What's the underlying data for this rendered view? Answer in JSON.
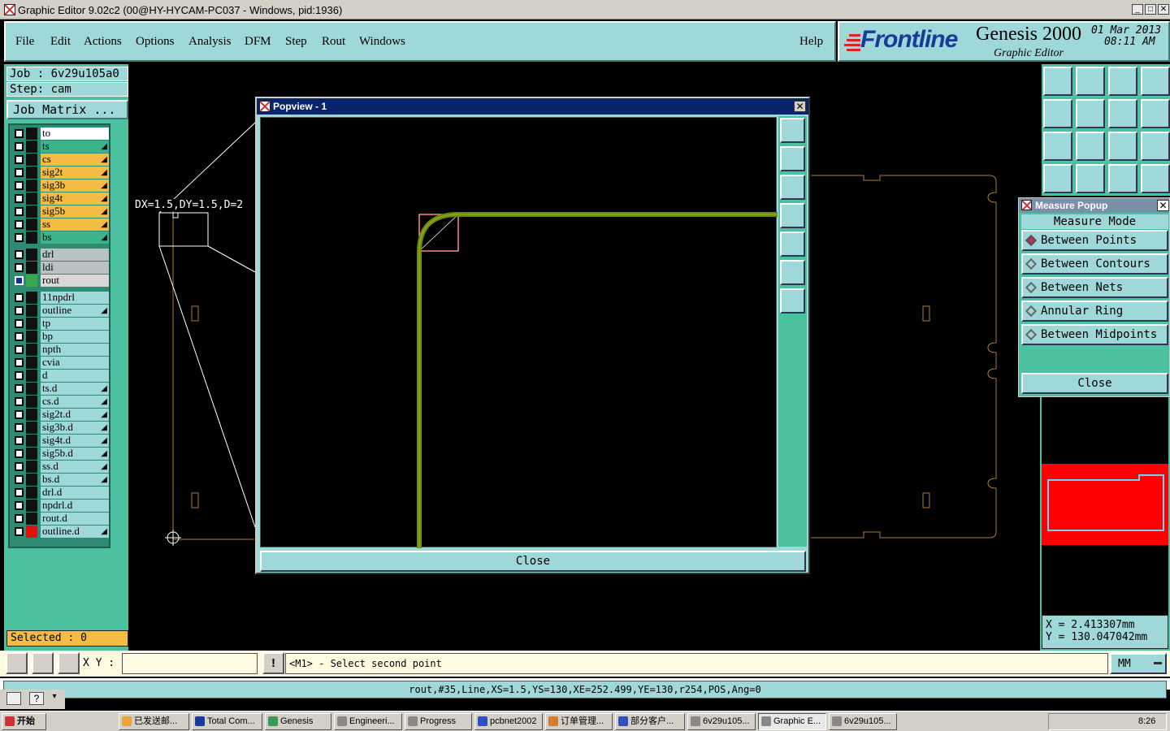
{
  "window": {
    "title": "Graphic Editor 9.02c2 (00@HY-HYCAM-PC037 - Windows, pid:1936)"
  },
  "menu": {
    "items": [
      "File",
      "Edit",
      "Actions",
      "Options",
      "Analysis",
      "DFM",
      "Step",
      "Rout",
      "Windows"
    ],
    "help": "Help"
  },
  "brand": {
    "logo": "Frontline",
    "product": "Genesis 2000",
    "subtitle": "Graphic Editor",
    "date": "01 Mar 2013",
    "time": "08:11 AM"
  },
  "left": {
    "job": "Job  : 6v29u105a0",
    "step": "Step: cam",
    "job_matrix": "Job Matrix ...",
    "selected": "Selected : 0",
    "layers": [
      {
        "name": "to",
        "color": "#ffffff",
        "swatch": "#111111"
      },
      {
        "name": "ts",
        "color": "#3cb38a",
        "swatch": "#111111",
        "arrow": true
      },
      {
        "name": "cs",
        "color": "#f5bc43",
        "swatch": "#111111",
        "arrow": true
      },
      {
        "name": "sig2t",
        "color": "#f5bc43",
        "swatch": "#111111",
        "arrow": true
      },
      {
        "name": "sig3b",
        "color": "#f5bc43",
        "swatch": "#111111",
        "arrow": true
      },
      {
        "name": "sig4t",
        "color": "#f5bc43",
        "swatch": "#111111",
        "arrow": true
      },
      {
        "name": "sig5b",
        "color": "#f5bc43",
        "swatch": "#111111",
        "arrow": true
      },
      {
        "name": "ss",
        "color": "#f5bc43",
        "swatch": "#111111",
        "arrow": true
      },
      {
        "name": "bs",
        "color": "#3cb38a",
        "swatch": "#111111",
        "arrow": true
      },
      {
        "name": "drl",
        "color": "#b8c4c4",
        "swatch": "#111111"
      },
      {
        "name": "ldi",
        "color": "#b8c4c4",
        "swatch": "#111111"
      },
      {
        "name": "rout",
        "color": "#d8d8d8",
        "swatch": "#3aa84a",
        "active": true
      },
      {
        "name": "11npdrl",
        "color": "#9ed8d8",
        "swatch": "#111111"
      },
      {
        "name": "outline",
        "color": "#9ed8d8",
        "swatch": "#111111",
        "arrow": true
      },
      {
        "name": "tp",
        "color": "#9ed8d8",
        "swatch": "#111111"
      },
      {
        "name": "bp",
        "color": "#9ed8d8",
        "swatch": "#111111"
      },
      {
        "name": "npth",
        "color": "#9ed8d8",
        "swatch": "#111111"
      },
      {
        "name": "cvia",
        "color": "#9ed8d8",
        "swatch": "#111111"
      },
      {
        "name": "d",
        "color": "#9ed8d8",
        "swatch": "#111111"
      },
      {
        "name": "ts.d",
        "color": "#9ed8d8",
        "swatch": "#111111",
        "arrow": true
      },
      {
        "name": "cs.d",
        "color": "#9ed8d8",
        "swatch": "#111111",
        "arrow": true
      },
      {
        "name": "sig2t.d",
        "color": "#9ed8d8",
        "swatch": "#111111",
        "arrow": true
      },
      {
        "name": "sig3b.d",
        "color": "#9ed8d8",
        "swatch": "#111111",
        "arrow": true
      },
      {
        "name": "sig4t.d",
        "color": "#9ed8d8",
        "swatch": "#111111",
        "arrow": true
      },
      {
        "name": "sig5b.d",
        "color": "#9ed8d8",
        "swatch": "#111111",
        "arrow": true
      },
      {
        "name": "ss.d",
        "color": "#9ed8d8",
        "swatch": "#111111",
        "arrow": true
      },
      {
        "name": "bs.d",
        "color": "#9ed8d8",
        "swatch": "#111111",
        "arrow": true
      },
      {
        "name": "drl.d",
        "color": "#9ed8d8",
        "swatch": "#111111"
      },
      {
        "name": "npdrl.d",
        "color": "#9ed8d8",
        "swatch": "#111111"
      },
      {
        "name": "rout.d",
        "color": "#9ed8d8",
        "swatch": "#111111"
      },
      {
        "name": "outline.d",
        "color": "#9ed8d8",
        "swatch": "#e01010",
        "arrow": true
      }
    ]
  },
  "canvas": {
    "measure_label": "DX=1.5,DY=1.5,D=2"
  },
  "popview": {
    "title": "Popview - 1",
    "close": "Close"
  },
  "measure": {
    "title": "Measure Popup",
    "heading": "Measure Mode",
    "options": [
      "Between Points",
      "Between Contours",
      "Between Nets",
      "Annular Ring",
      "Between Midpoints"
    ],
    "selected_index": 0,
    "close": "Close"
  },
  "coords": {
    "x": "X  = 2.413307mm",
    "y": "Y  = 130.047042mm"
  },
  "command": {
    "xy_label": "X Y :",
    "xy_value": "",
    "prompt": "<M1> - Select second point",
    "units": "MM"
  },
  "status": {
    "text": "rout,#35,Line,XS=1.5,YS=130,XE=252.499,YE=130,r254,POS,Ang=0"
  },
  "taskbar": {
    "start": "开始",
    "items": [
      "已发送邮...",
      "Total Com...",
      "Genesis",
      "Engineeri...",
      "Progress",
      "pcbnet2002",
      "订单管理...",
      "部分客户...",
      "6v29u105...",
      "Graphic E...",
      "6v29u105..."
    ],
    "active_index": 9,
    "clock": "8:26"
  },
  "colors": {
    "panel": "#9ed8d8",
    "panel_dark": "#4cc19f",
    "trace": "#6b8c10",
    "board_outline": "#b07a3a",
    "highlight": "#ff0000"
  }
}
